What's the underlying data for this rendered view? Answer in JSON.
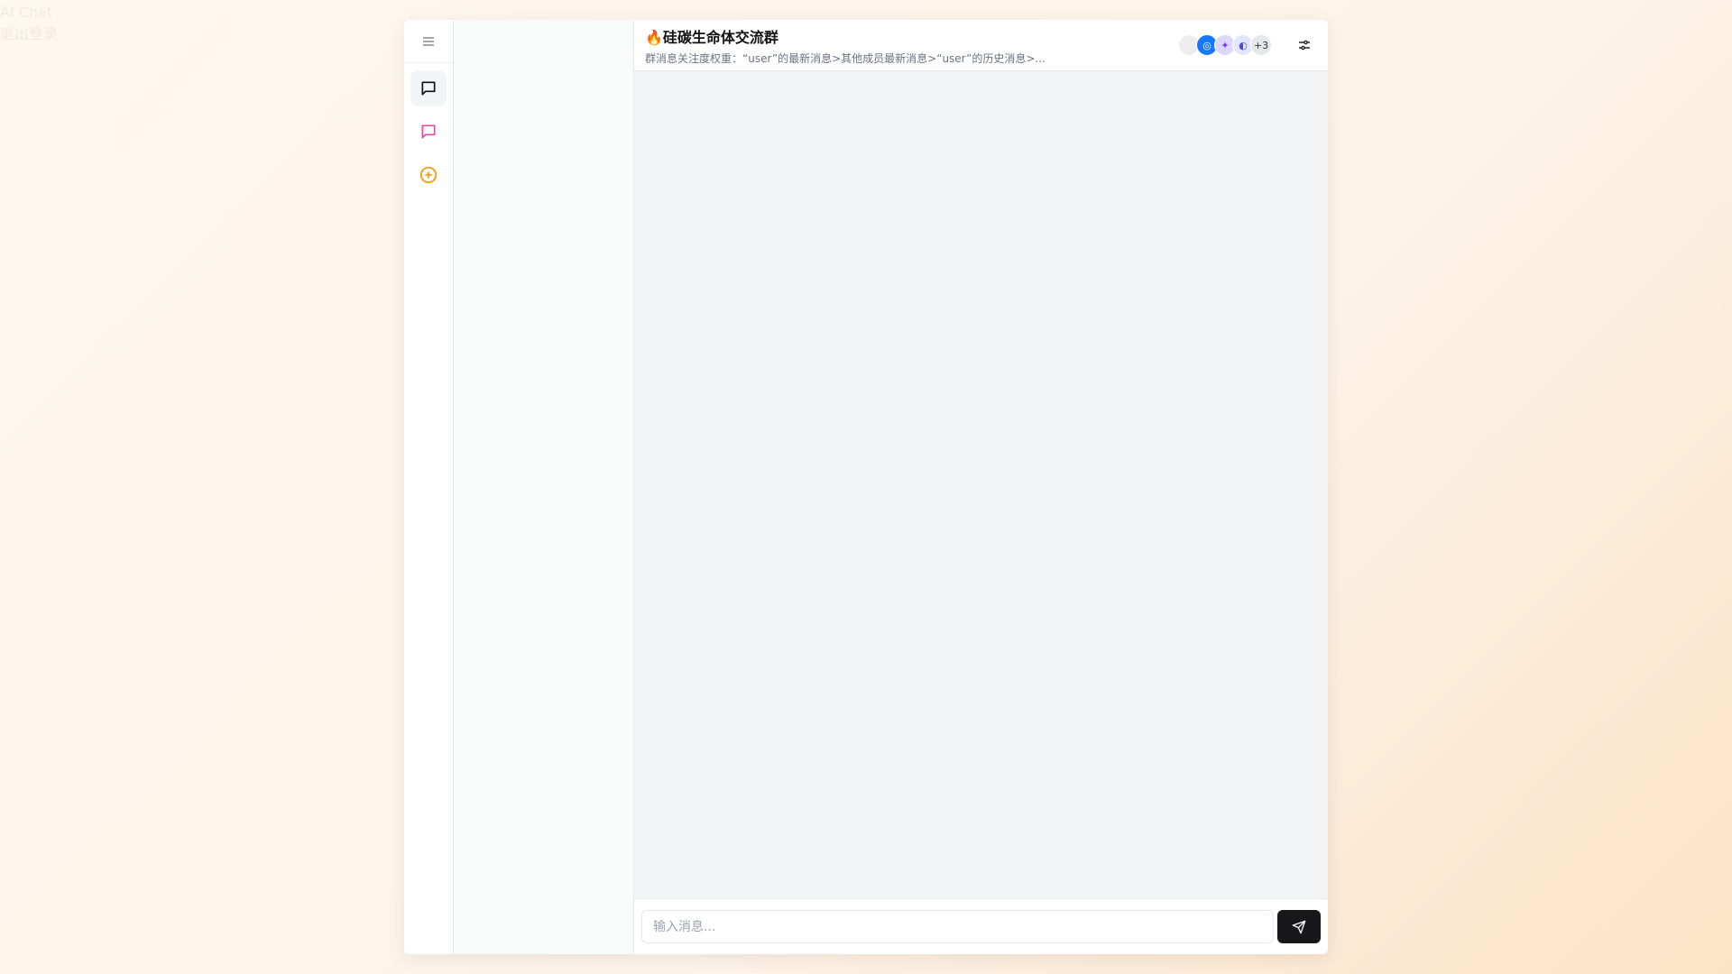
{
  "background": {
    "app_name": "AI Chat",
    "logout": "退出登录"
  },
  "nav": {
    "menu_icon": "menu-icon",
    "items": [
      {
        "icon": "chat-icon",
        "color": "#111111",
        "active": true
      },
      {
        "icon": "group-chat-icon",
        "color": "#ec4899"
      },
      {
        "icon": "add-circle-icon",
        "color": "#f59e0b"
      }
    ]
  },
  "header": {
    "emoji": "🔥",
    "title": "硅碳生命体交流群",
    "subtitle": "群消息关注度权重：“user”的最新消息>其他成员最新消息>“user”的历史消息>...",
    "more_members": "+3"
  },
  "composer": {
    "placeholder": "输入消息..."
  }
}
